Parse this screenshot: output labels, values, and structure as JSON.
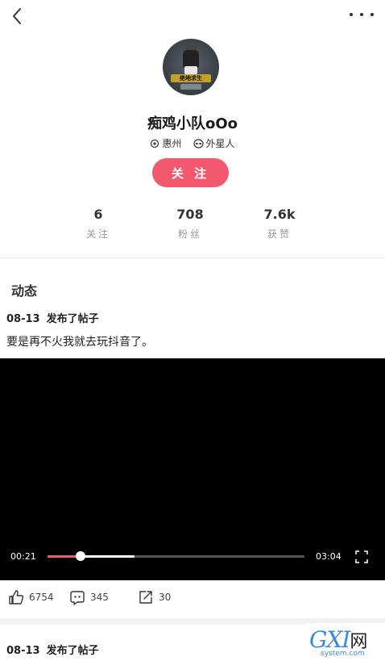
{
  "profile": {
    "username": "痴鸡小队oOo",
    "location": "惠州",
    "species": "外星人",
    "follow_label": "关 注",
    "avatar_badge": "绝地求生"
  },
  "stats": [
    {
      "value": "6",
      "label": "关注"
    },
    {
      "value": "708",
      "label": "粉丝"
    },
    {
      "value": "7.6k",
      "label": "获赞"
    }
  ],
  "feed": {
    "section_title": "动态",
    "posts": [
      {
        "date": "08-13",
        "action": "发布了帖子",
        "text": "要是再不火我就去玩抖音了。",
        "video": {
          "current_time": "00:21",
          "total_time": "03:04",
          "played_fraction": 0.13,
          "buffered_fraction": 0.34
        },
        "likes": "6754",
        "comments": "345",
        "shares": "30"
      },
      {
        "date": "08-13",
        "action": "发布了帖子"
      }
    ]
  },
  "watermark": {
    "logo": "GXI",
    "logo_suffix": "网",
    "site": "system.com"
  },
  "colors": {
    "accent": "#f2596f",
    "video_bg": "#000000",
    "watermark_blue": "#3a8bd6"
  }
}
